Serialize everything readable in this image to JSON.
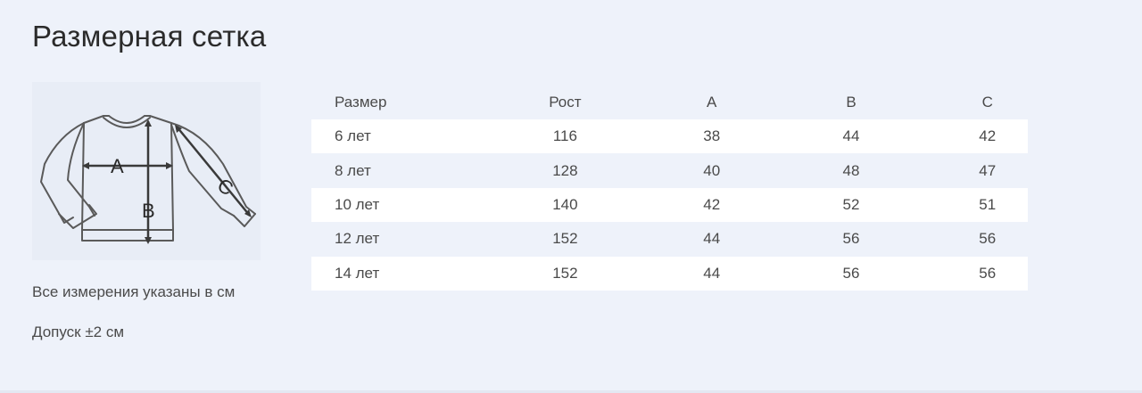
{
  "page": {
    "title": "Размерная сетка"
  },
  "diagram": {
    "label_a": "A",
    "label_b": "B",
    "label_c": "C"
  },
  "notes": {
    "measurements": "Все измерения указаны в см",
    "tolerance": "Допуск ±2 см"
  },
  "table": {
    "headers": [
      "Размер",
      "Рост",
      "A",
      "B",
      "C"
    ],
    "rows": [
      [
        "6 лет",
        "116",
        "38",
        "44",
        "42"
      ],
      [
        "8 лет",
        "128",
        "40",
        "48",
        "47"
      ],
      [
        "10 лет",
        "140",
        "42",
        "52",
        "51"
      ],
      [
        "12 лет",
        "152",
        "44",
        "56",
        "56"
      ],
      [
        "14 лет",
        "152",
        "44",
        "56",
        "56"
      ]
    ]
  },
  "colors": {
    "background": "#eef2fa",
    "row_highlight": "#ffffff",
    "text": "#4a4a4a"
  }
}
